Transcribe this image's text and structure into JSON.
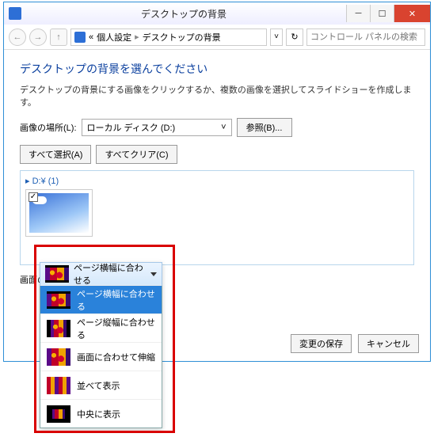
{
  "title": "デスクトップの背景",
  "breadcrumbs": {
    "a": "個人設定",
    "b": "デスクトップの背景"
  },
  "search_placeholder": "コントロール パネルの検索",
  "heading": "デスクトップの背景を選んでください",
  "desc": "デスクトップの背景にする画像をクリックするか、複数の画像を選択してスライドショーを作成します。",
  "location_label": "画像の場所(L):",
  "location_value": "ローカル ディスク (D:)",
  "browse": "参照(B)...",
  "select_all": "すべて選択(A)",
  "clear_all": "すべてクリア(C)",
  "group": "D:¥ (1)",
  "picpos_label": "画面の配置(P):",
  "dropdown": {
    "selected": "ページ横幅に合わせる",
    "items": [
      "ページ横幅に合わせる",
      "ページ縦幅に合わせる",
      "画面に合わせて伸縮",
      "並べて表示",
      "中央に表示"
    ]
  },
  "save": "変更の保存",
  "cancel": "キャンセル"
}
